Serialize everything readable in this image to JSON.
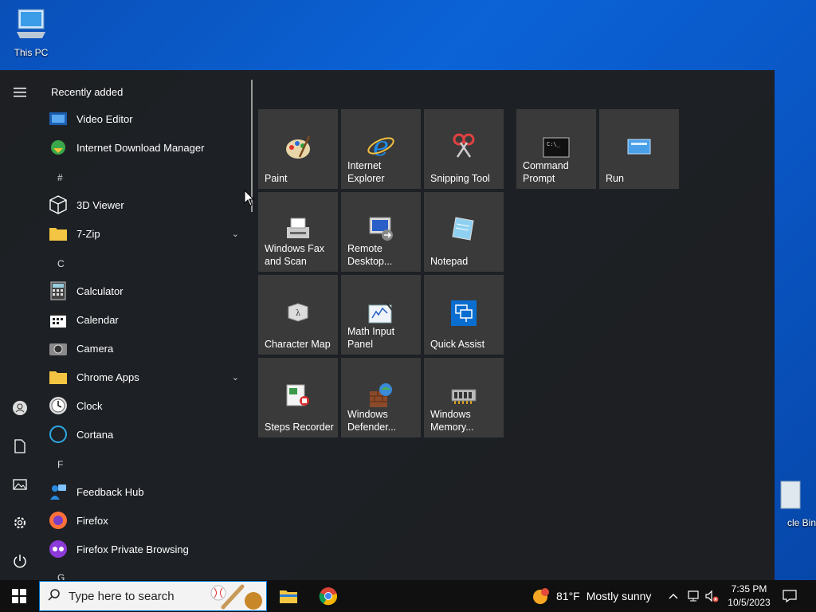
{
  "desktop": {
    "this_pc_label": "This PC",
    "recycle_label": "cle Bin"
  },
  "start_menu": {
    "recently_added_header": "Recently added",
    "apps": [
      {
        "label": "Video Editor",
        "icon": "video-editor-icon"
      },
      {
        "label": "Internet Download Manager",
        "icon": "idm-icon"
      },
      {
        "letter": "#"
      },
      {
        "label": "3D Viewer",
        "icon": "3d-viewer-icon"
      },
      {
        "label": "7-Zip",
        "icon": "folder-icon",
        "expandable": true
      },
      {
        "letter": "C"
      },
      {
        "label": "Calculator",
        "icon": "calculator-icon"
      },
      {
        "label": "Calendar",
        "icon": "calendar-icon"
      },
      {
        "label": "Camera",
        "icon": "camera-icon"
      },
      {
        "label": "Chrome Apps",
        "icon": "folder-icon",
        "expandable": true
      },
      {
        "label": "Clock",
        "icon": "clock-icon"
      },
      {
        "label": "Cortana",
        "icon": "cortana-icon"
      },
      {
        "letter": "F"
      },
      {
        "label": "Feedback Hub",
        "icon": "feedback-hub-icon"
      },
      {
        "label": "Firefox",
        "icon": "firefox-icon"
      },
      {
        "label": "Firefox Private Browsing",
        "icon": "firefox-private-icon"
      },
      {
        "letter": "G"
      }
    ],
    "letters": {
      "hash": "#",
      "c": "C",
      "f": "F",
      "g": "G"
    },
    "tiles": [
      {
        "label": "Paint",
        "icon": "paint-icon"
      },
      {
        "label": "Internet\nExplorer",
        "icon": "internet-explorer-icon"
      },
      {
        "label": "Snipping Tool",
        "icon": "snipping-tool-icon"
      },
      {
        "label": "Command\nPrompt",
        "icon": "command-prompt-icon"
      },
      {
        "label": "Run",
        "icon": "run-icon"
      },
      {
        "label": "Windows Fax\nand Scan",
        "icon": "fax-scan-icon"
      },
      {
        "label": "Remote\nDesktop...",
        "icon": "remote-desktop-icon"
      },
      {
        "label": "Notepad",
        "icon": "notepad-icon"
      },
      {
        "label": "Character Map",
        "icon": "character-map-icon"
      },
      {
        "label": "Math Input\nPanel",
        "icon": "math-input-icon"
      },
      {
        "label": "Quick Assist",
        "icon": "quick-assist-icon"
      },
      {
        "label": "Steps Recorder",
        "icon": "steps-recorder-icon"
      },
      {
        "label": "Windows\nDefender...",
        "icon": "windows-defender-icon"
      },
      {
        "label": "Windows\nMemory...",
        "icon": "windows-memory-icon"
      }
    ]
  },
  "taskbar": {
    "search_placeholder": "Type here to search",
    "weather_temp": "81°F",
    "weather_text": "Mostly sunny",
    "time": "7:35 PM",
    "date": "10/5/2023"
  },
  "colors": {
    "accent": "#0078d7",
    "start_bg": "#1e1e1e",
    "tile_bg": "#3a3a3a",
    "taskbar_bg": "#101010"
  }
}
